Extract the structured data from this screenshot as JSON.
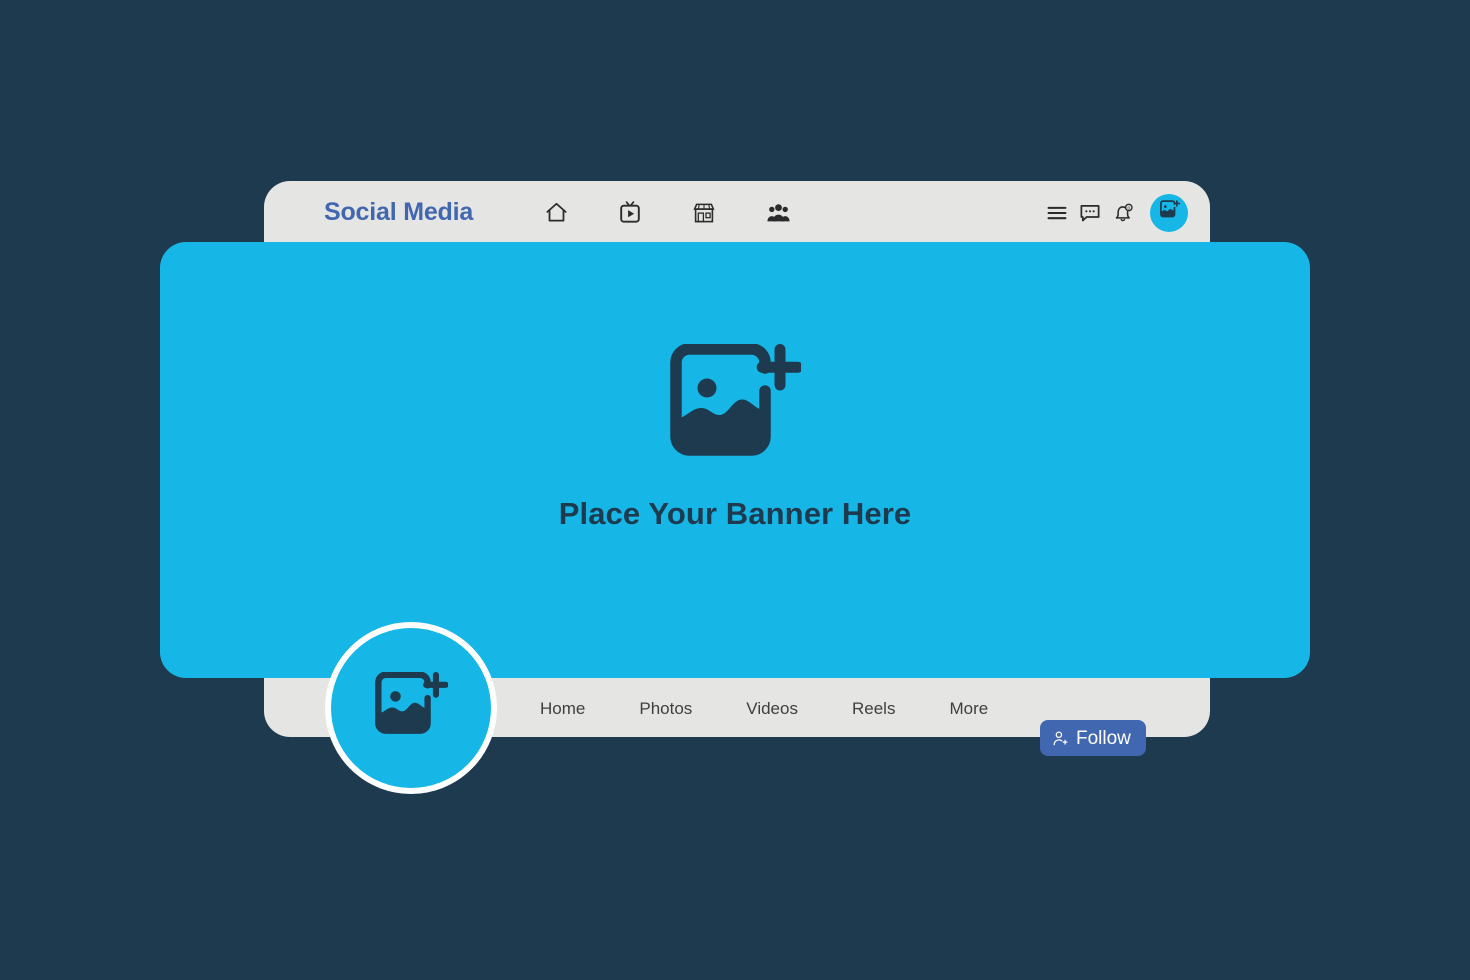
{
  "page": {
    "background_color": "#1d3a4f",
    "card_color": "#e5e5e3",
    "accent_cyan": "#16b7e6",
    "brand_blue": "#4067b0",
    "dark_navy": "#1d3a4f"
  },
  "header": {
    "brand_title": "Social Media",
    "nav_icons": [
      {
        "name": "home-icon",
        "label": "Home"
      },
      {
        "name": "watch-video-icon",
        "label": "Watch"
      },
      {
        "name": "marketplace-store-icon",
        "label": "Marketplace"
      },
      {
        "name": "groups-people-icon",
        "label": "Groups"
      }
    ],
    "actions": [
      {
        "name": "menu-hamburger-icon",
        "label": "Menu"
      },
      {
        "name": "messages-chat-icon",
        "label": "Messages"
      },
      {
        "name": "notifications-bell-icon",
        "label": "Notifications",
        "badge": "0"
      }
    ],
    "account_avatar": {
      "name": "account-avatar-image-icon",
      "label": "Account",
      "color": "#16b7e6"
    }
  },
  "banner": {
    "placeholder_text": "Place Your Banner Here",
    "icon_name": "add-image-icon",
    "background_color": "#16b7e6",
    "text_color": "#1d3a4f"
  },
  "profile": {
    "avatar_icon_name": "add-image-icon",
    "avatar_background": "#16b7e6",
    "avatar_border_color": "#ffffff"
  },
  "tabs": [
    {
      "label": "Home"
    },
    {
      "label": "Photos"
    },
    {
      "label": "Videos"
    },
    {
      "label": "Reels"
    },
    {
      "label": "More"
    }
  ],
  "follow": {
    "label": "Follow",
    "icon_name": "person-add-icon",
    "background_color": "#4067b0",
    "text_color": "#ffffff"
  }
}
